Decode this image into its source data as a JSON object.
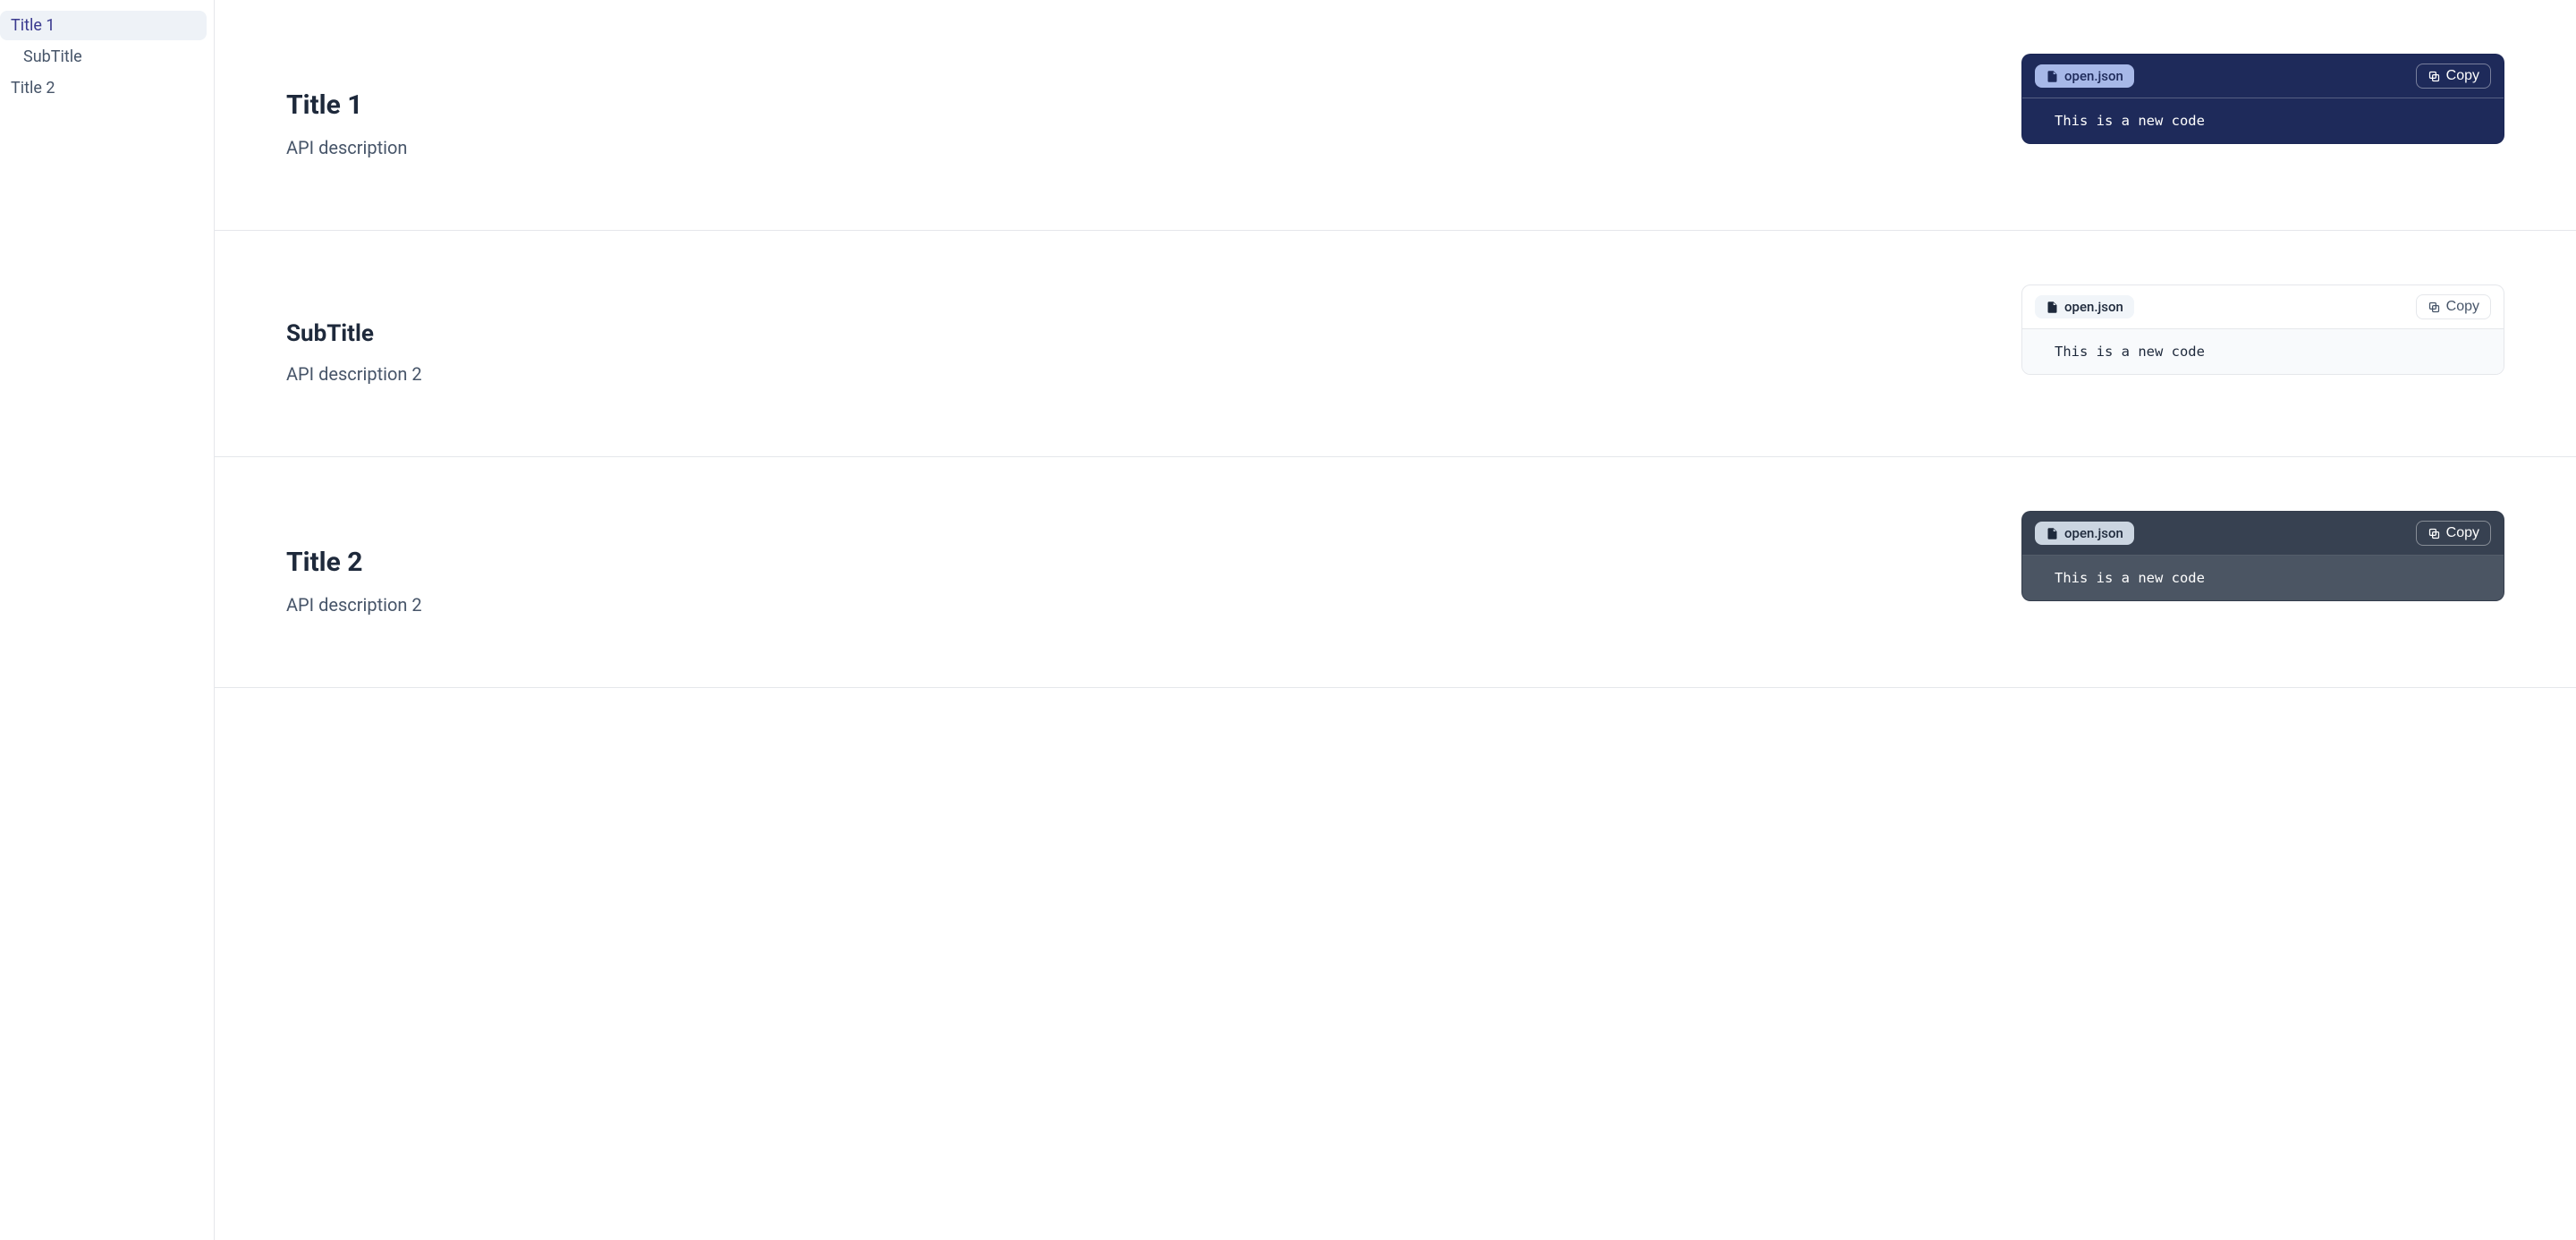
{
  "sidebar": {
    "items": [
      {
        "label": "Title 1",
        "active": true,
        "sub": false
      },
      {
        "label": "SubTitle",
        "active": false,
        "sub": true
      },
      {
        "label": "Title 2",
        "active": false,
        "sub": false
      }
    ]
  },
  "copy_label": "Copy",
  "sections": [
    {
      "title": "Title 1",
      "title_level": "h1",
      "description": "API description",
      "code": {
        "filename": "open.json",
        "content": "This is a new code",
        "theme": "navy"
      }
    },
    {
      "title": "SubTitle",
      "title_level": "h2",
      "description": "API description 2",
      "code": {
        "filename": "open.json",
        "content": "This is a new code",
        "theme": "light"
      }
    },
    {
      "title": "Title 2",
      "title_level": "h1",
      "description": "API description 2",
      "code": {
        "filename": "open.json",
        "content": "This is a new code",
        "theme": "slate"
      }
    }
  ]
}
